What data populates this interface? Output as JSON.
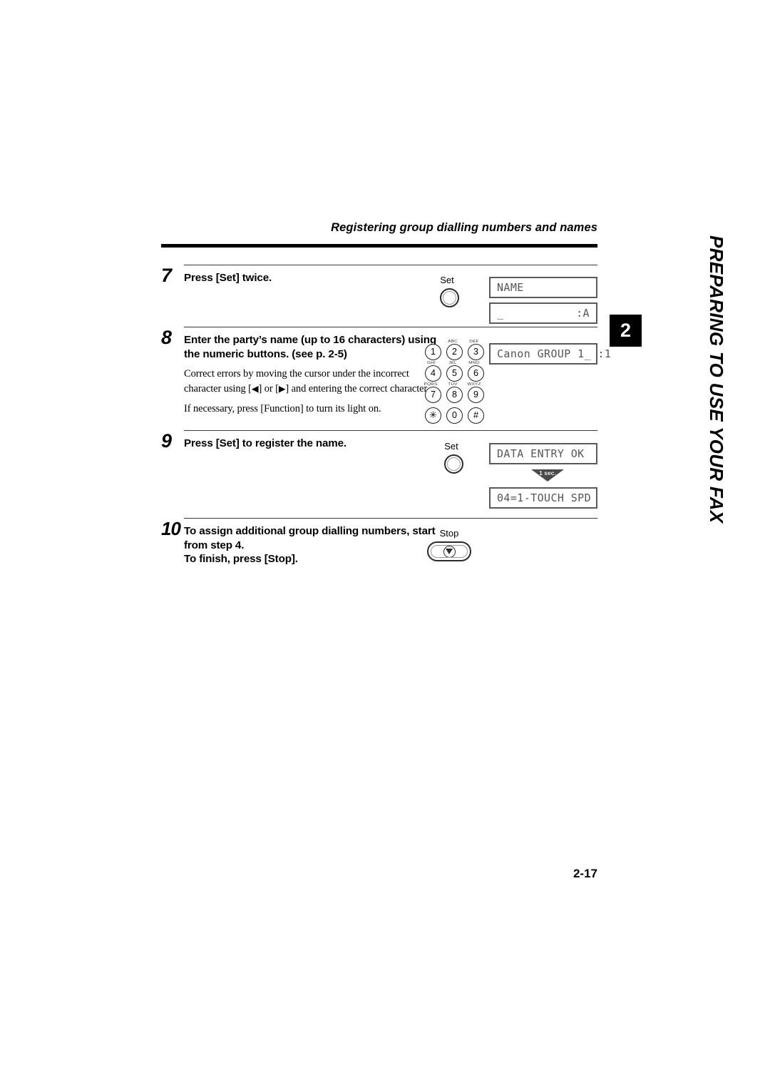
{
  "header": {
    "running_head": "Registering group dialling numbers and names"
  },
  "sidebar": {
    "chapter_number": "2",
    "chapter_title": "PREPARING TO USE YOUR FAX"
  },
  "folio": {
    "page_number": "2-17"
  },
  "steps": [
    {
      "number": "7",
      "heading": "Press [Set] twice.",
      "paragraphs": [],
      "button_label": "Set",
      "displays": [
        {
          "left": "NAME",
          "right": ""
        },
        {
          "left": "_",
          "right": ":A"
        }
      ]
    },
    {
      "number": "8",
      "heading": "Enter the party’s name (up to 16 characters) using the numeric buttons. (see p. 2-5)",
      "paragraphs": [
        "Correct errors by moving the cursor under the incorrect character using [<] or [>] and entering the correct character.",
        "If necessary, press [Function] to turn its light on."
      ],
      "displays": [
        {
          "left": "Canon GROUP 1_ :1",
          "right": ""
        }
      ]
    },
    {
      "number": "9",
      "heading": "Press [Set] to register the name.",
      "paragraphs": [],
      "button_label": "Set",
      "transition_label": "1 sec.",
      "displays": [
        {
          "left": "DATA ENTRY OK",
          "right": ""
        },
        {
          "left": "04=1-TOUCH SPD",
          "right": ""
        }
      ]
    },
    {
      "number": "10",
      "heading": "To assign additional group dialling numbers, start from step 4.",
      "heading2": "To finish, press [Stop].",
      "paragraphs": [],
      "button_label": "Stop"
    }
  ],
  "step8_text": {
    "line1a": "Correct errors by moving the cursor under the incorrect",
    "line1b": "character using [",
    "arrow_left": "◀",
    "line1c": "] or [",
    "arrow_right": "▶",
    "line1d": "] and entering the correct",
    "line1e": "character.",
    "line2": "If necessary, press [Function] to turn its light on."
  },
  "keypad": {
    "keys": [
      {
        "digit": "1",
        "letters": ""
      },
      {
        "digit": "2",
        "letters": "ABC"
      },
      {
        "digit": "3",
        "letters": "DEF"
      },
      {
        "digit": "4",
        "letters": "GHI"
      },
      {
        "digit": "5",
        "letters": "JKL"
      },
      {
        "digit": "6",
        "letters": "MNO"
      },
      {
        "digit": "7",
        "letters": "PQRS"
      },
      {
        "digit": "8",
        "letters": "TUV"
      },
      {
        "digit": "9",
        "letters": "WXYZ"
      },
      {
        "digit": "✳",
        "letters": ""
      },
      {
        "digit": "0",
        "letters": ""
      },
      {
        "digit": "#",
        "letters": ""
      }
    ]
  },
  "colors": {
    "ink": "#000000",
    "lcd_border": "#5a5a5a",
    "lcd_text": "#55565a",
    "paper": "#ffffff"
  }
}
